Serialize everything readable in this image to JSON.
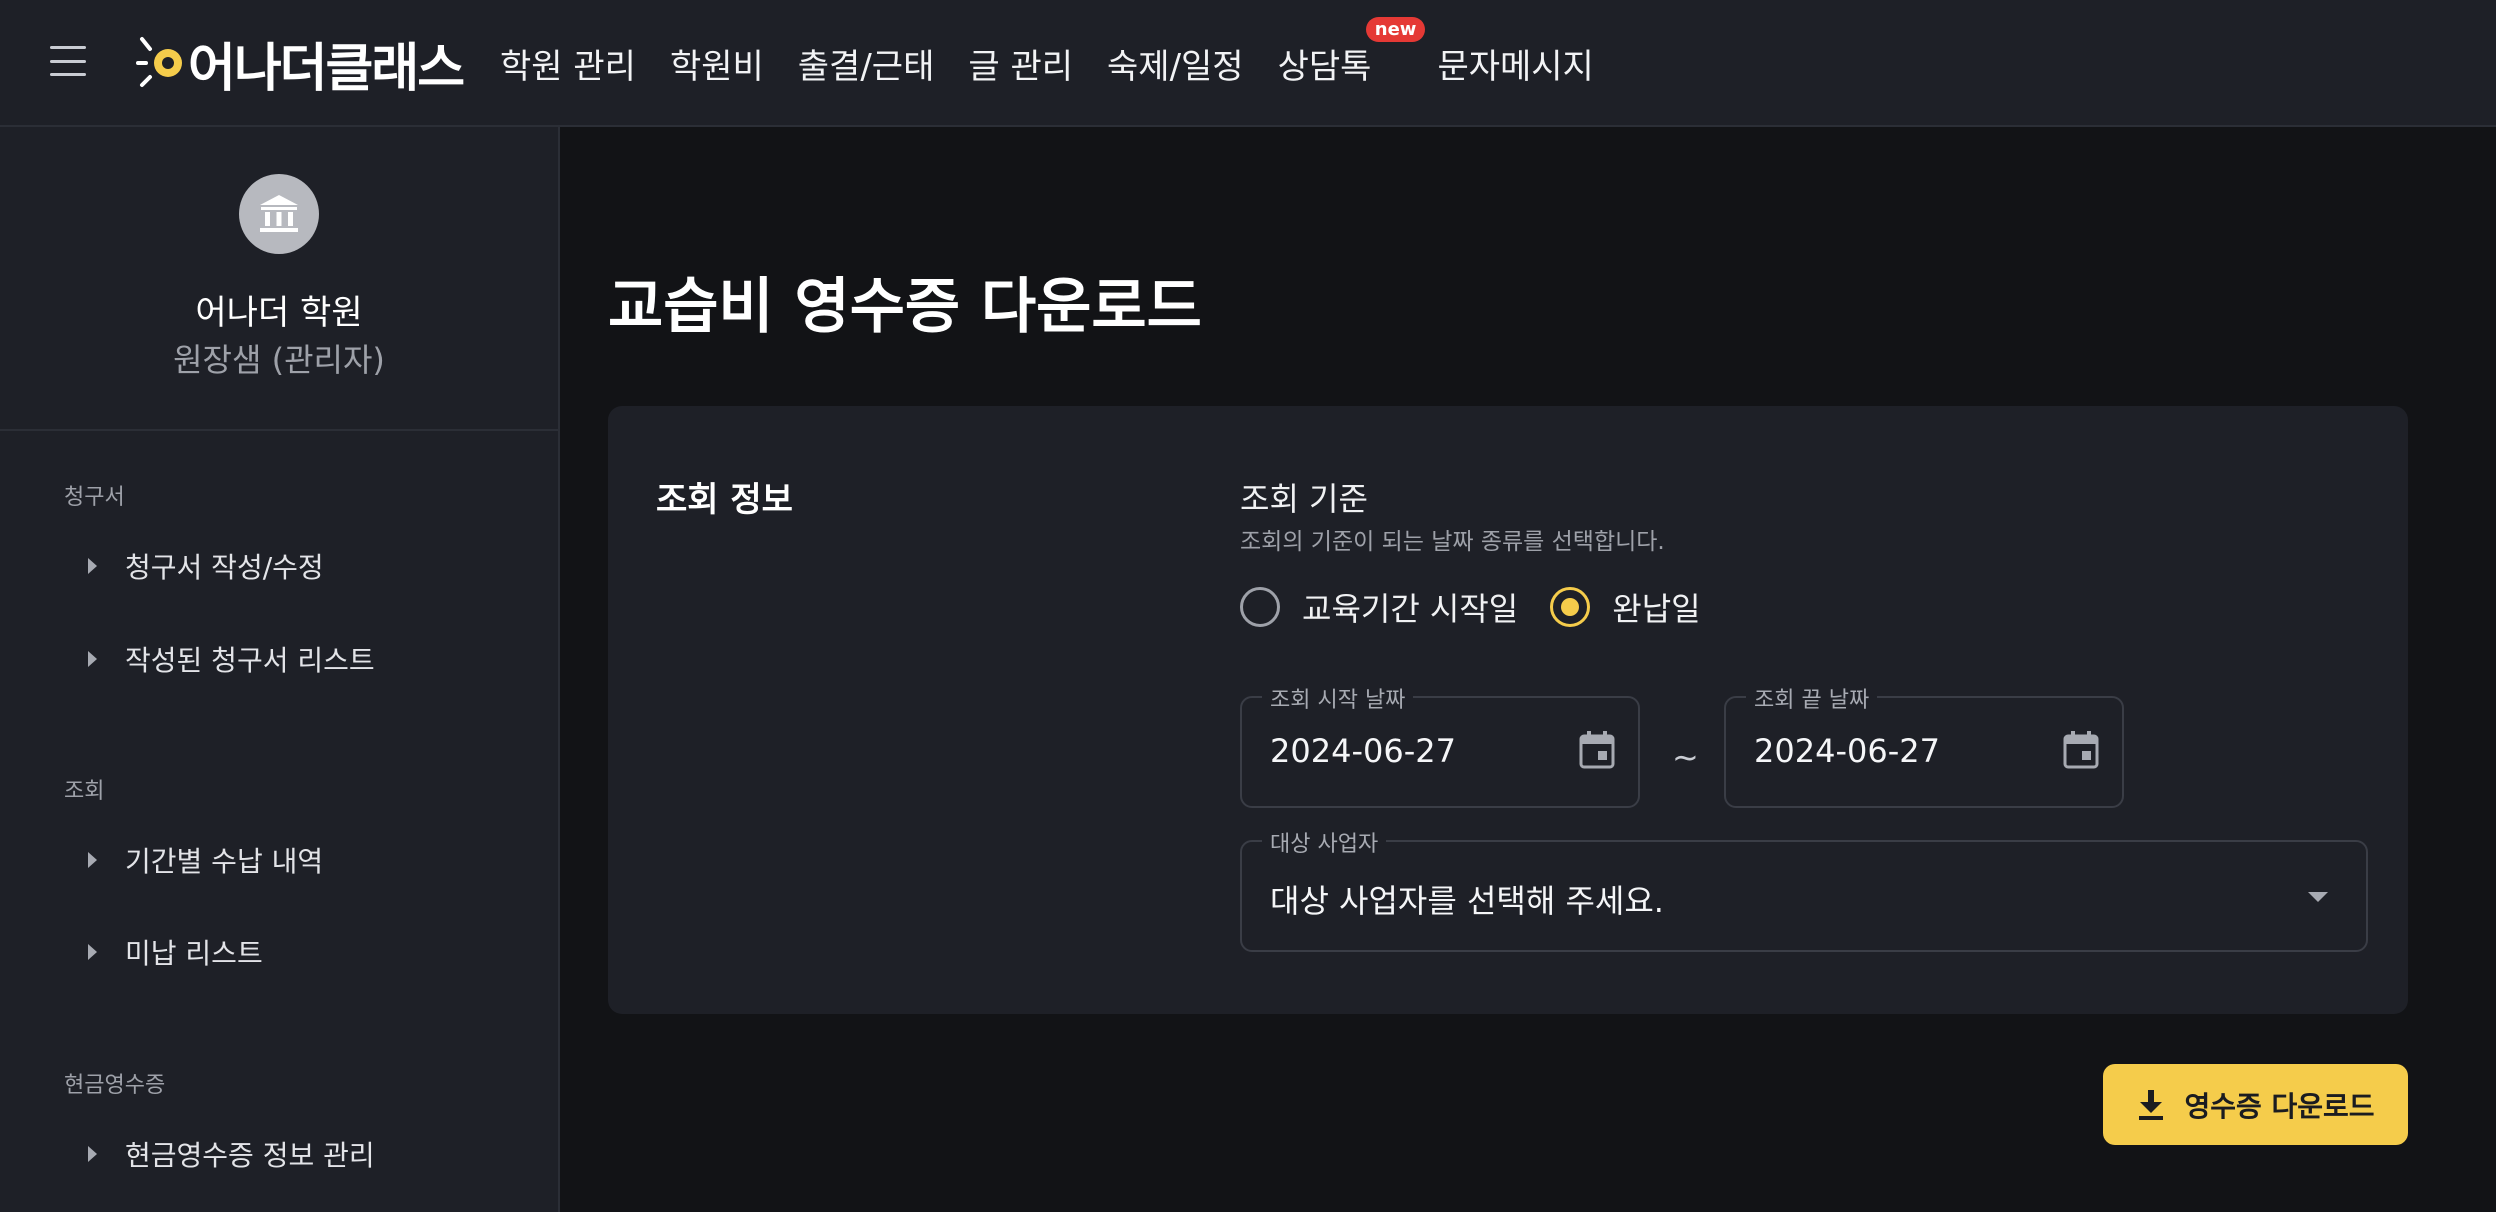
{
  "header": {
    "logo_text": "어나더클래스",
    "nav": [
      {
        "label": "학원 관리"
      },
      {
        "label": "학원비"
      },
      {
        "label": "출결/근태"
      },
      {
        "label": "글 관리"
      },
      {
        "label": "숙제/일정"
      },
      {
        "label": "상담톡",
        "badge": "new"
      },
      {
        "label": "문자메시지"
      }
    ]
  },
  "sidebar": {
    "org_name": "어나더 학원",
    "org_role": "원장샘 (관리자)",
    "sections": [
      {
        "label": "청구서",
        "items": [
          {
            "label": "청구서 작성/수정"
          },
          {
            "label": "작성된 청구서 리스트"
          }
        ]
      },
      {
        "label": "조회",
        "items": [
          {
            "label": "기간별 수납 내역"
          },
          {
            "label": "미납 리스트"
          }
        ]
      },
      {
        "label": "현금영수증",
        "items": [
          {
            "label": "현금영수증 정보 관리"
          }
        ]
      }
    ]
  },
  "main": {
    "title": "교습비 영수증 다운로드",
    "card_title": "조회 정보",
    "criteria_title": "조회 기준",
    "criteria_help": "조회의 기준이 되는 날짜 종류를 선택합니다.",
    "radios": [
      {
        "label": "교육기간 시작일",
        "checked": false
      },
      {
        "label": "완납일",
        "checked": true
      }
    ],
    "start_date_label": "조회 시작 날짜",
    "start_date_value": "2024-06-27",
    "tilde": "~",
    "end_date_label": "조회 끝 날짜",
    "end_date_value": "2024-06-27",
    "business_label": "대상 사업자",
    "business_placeholder": "대상 사업자를 선택해 주세요.",
    "download_label": "영수증 다운로드"
  },
  "colors": {
    "accent": "#f5cc4b",
    "background": "#121316",
    "surface": "#1e2027",
    "badge": "#e53935"
  },
  "icons": [
    "menu-icon",
    "bank-icon",
    "caret-right-icon",
    "calendar-icon",
    "dropdown-arrow-icon",
    "download-icon"
  ]
}
